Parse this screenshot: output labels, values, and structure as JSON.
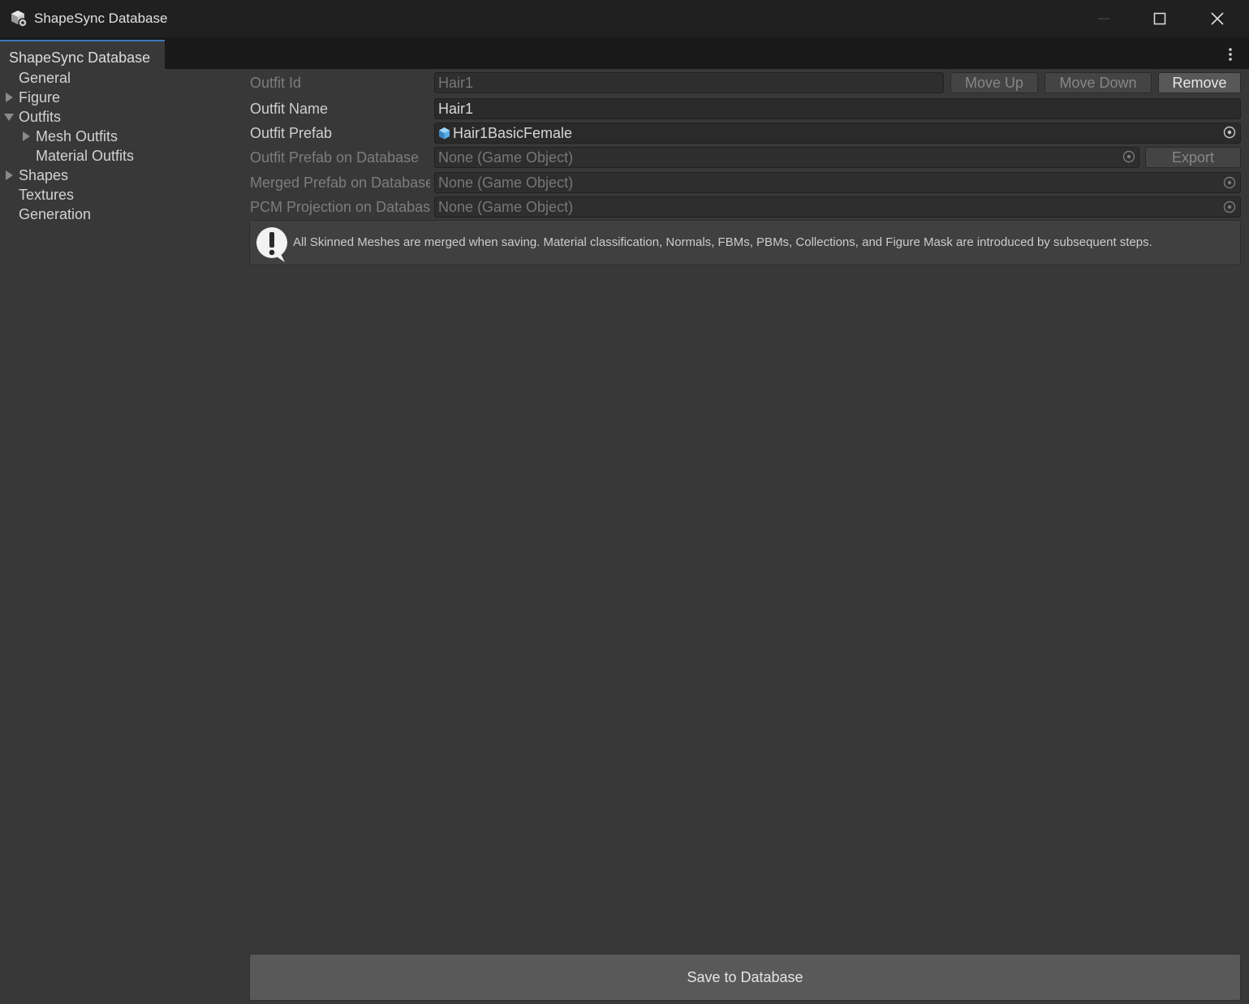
{
  "window": {
    "title": "ShapeSync Database"
  },
  "tab": {
    "label": "ShapeSync Database"
  },
  "sidebar": {
    "items": [
      {
        "label": "General",
        "expander": "none"
      },
      {
        "label": "Figure",
        "expander": "collapsed"
      },
      {
        "label": "Outfits",
        "expander": "expanded"
      },
      {
        "label": "Mesh Outfits",
        "expander": "collapsed"
      },
      {
        "label": "Material Outfits",
        "expander": "none"
      },
      {
        "label": "Shapes",
        "expander": "collapsed"
      },
      {
        "label": "Textures",
        "expander": "none"
      },
      {
        "label": "Generation",
        "expander": "none"
      }
    ]
  },
  "form": {
    "outfit_id": {
      "label": "Outfit Id",
      "value": "Hair1"
    },
    "outfit_name": {
      "label": "Outfit Name",
      "value": "Hair1"
    },
    "outfit_prefab": {
      "label": "Outfit Prefab",
      "value": "Hair1BasicFemale"
    },
    "outfit_prefab_db": {
      "label": "Outfit Prefab on Database",
      "value": "None (Game Object)"
    },
    "merged_prefab_db": {
      "label": "Merged Prefab on Database",
      "value": "None (Game Object)"
    },
    "pcm_projection_db": {
      "label": "PCM Projection on Database",
      "value": "None (Game Object)"
    }
  },
  "buttons": {
    "move_up": "Move Up",
    "move_down": "Move Down",
    "remove": "Remove",
    "export": "Export",
    "save": "Save to Database"
  },
  "help": {
    "message": "All Skinned Meshes are merged when saving. Material classification, Normals, FBMs, PBMs, Collections, and Figure Mask are introduced by subsequent steps."
  },
  "colors": {
    "accent": "#3a79bb",
    "background": "#383838",
    "titlebar": "#202020"
  }
}
